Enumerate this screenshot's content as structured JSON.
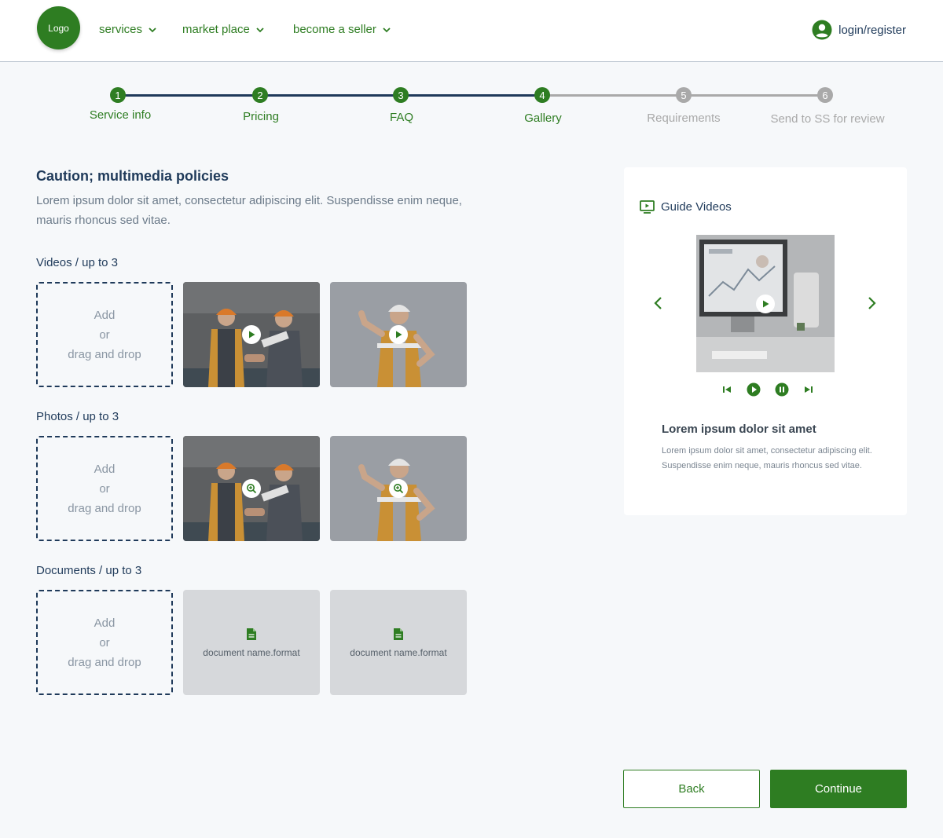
{
  "header": {
    "logo": "Logo",
    "nav": [
      {
        "label": "services"
      },
      {
        "label": "market place"
      },
      {
        "label": "become a seller"
      }
    ],
    "login_label": "login/register"
  },
  "stepper": {
    "steps": [
      {
        "num": "1",
        "label": "Service info",
        "state": "done"
      },
      {
        "num": "2",
        "label": "Pricing",
        "state": "done"
      },
      {
        "num": "3",
        "label": "FAQ",
        "state": "done"
      },
      {
        "num": "4",
        "label": "Gallery",
        "state": "current"
      },
      {
        "num": "5",
        "label": "Requirements",
        "state": "todo"
      },
      {
        "num": "6",
        "label": "Send to SS for review",
        "state": "todo"
      }
    ]
  },
  "caution": {
    "title": "Caution; multimedia policies",
    "text": "Lorem ipsum dolor sit amet, consectetur adipiscing elit. Suspendisse enim neque, mauris rhoncus sed vitae."
  },
  "dropzone": {
    "line1": "Add",
    "line2": "or",
    "line3": "drag and drop"
  },
  "sections": {
    "videos": "Videos / up to 3",
    "photos": "Photos / up to 3",
    "documents": "Documents / up to 3"
  },
  "documents": [
    {
      "name": "document name.format"
    },
    {
      "name": "document name.format"
    }
  ],
  "guide": {
    "title": "Guide Videos",
    "heading": "Lorem ipsum dolor sit amet",
    "text": "Lorem ipsum dolor sit amet, consectetur adipiscing elit. Suspendisse enim neque, mauris rhoncus sed vitae."
  },
  "actions": {
    "back": "Back",
    "continue": "Continue"
  },
  "colors": {
    "primary": "#2e7d22",
    "navy": "#1f3a5a",
    "inactive": "#a9a9a9"
  }
}
